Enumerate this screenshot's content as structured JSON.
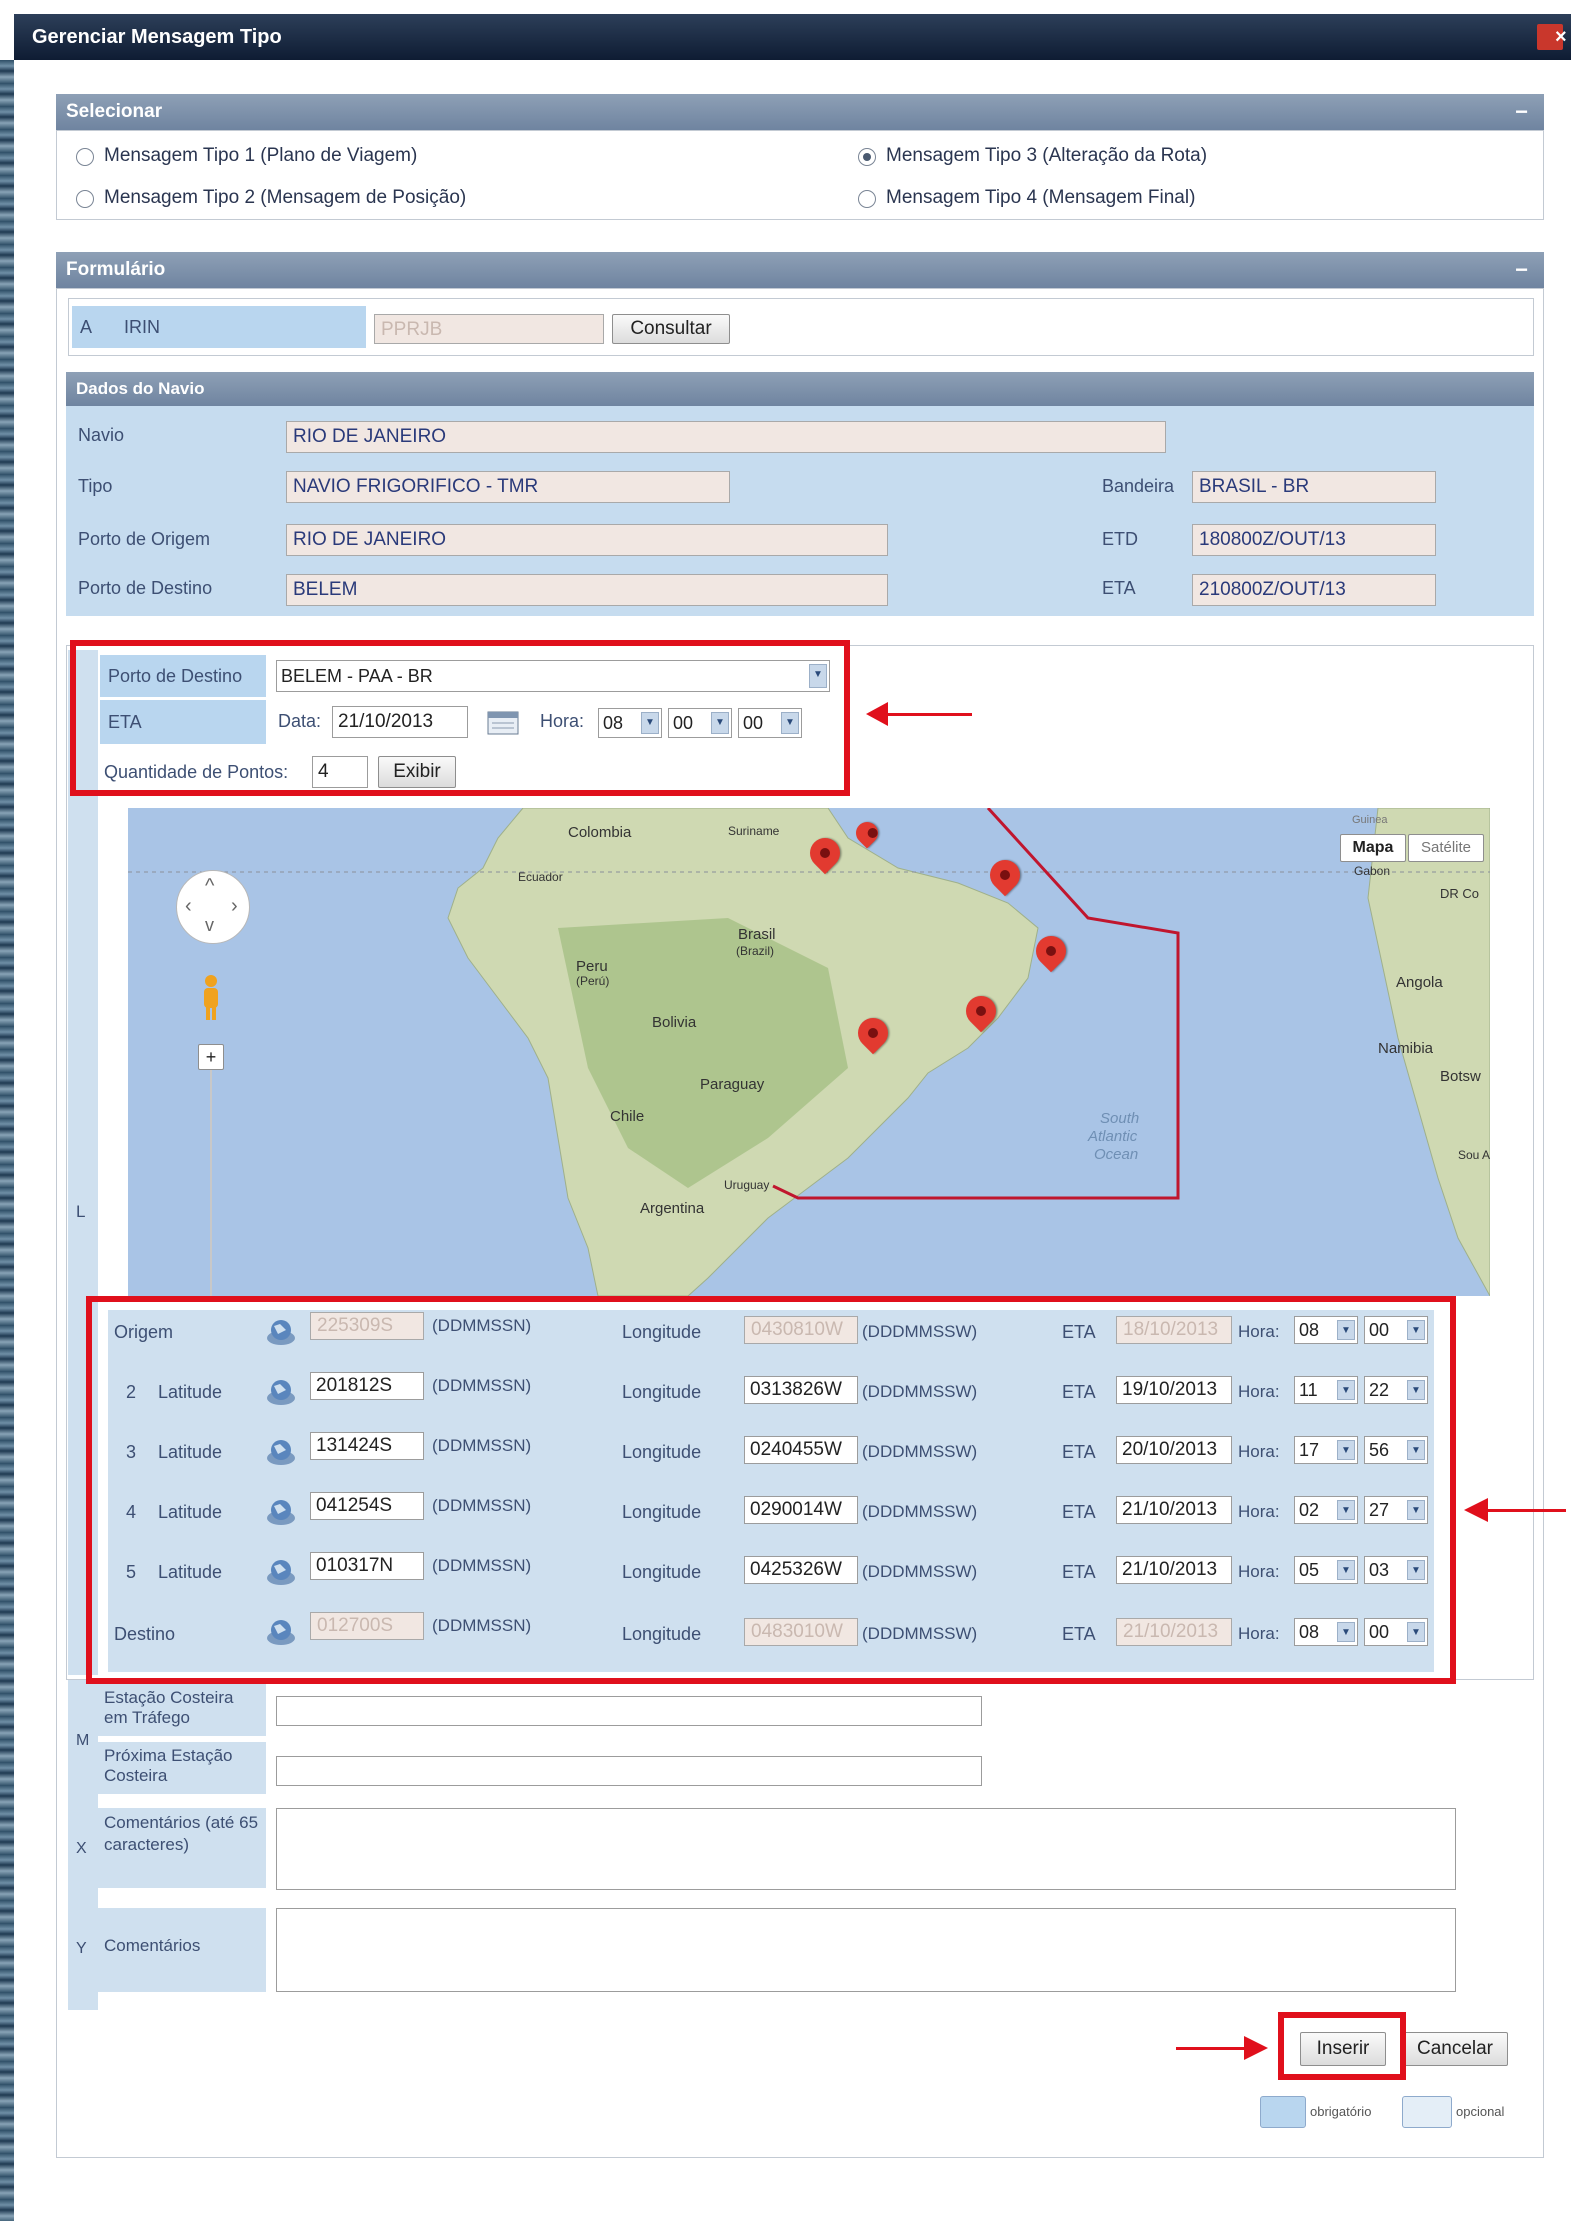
{
  "window": {
    "title": "Gerenciar Mensagem Tipo",
    "close": "×"
  },
  "selecionar": {
    "title": "Selecionar",
    "collapse": "−",
    "options": [
      {
        "label": "Mensagem Tipo 1 (Plano de Viagem)",
        "selected": false
      },
      {
        "label": "Mensagem Tipo 2 (Mensagem de Posição)",
        "selected": false
      },
      {
        "label": "Mensagem Tipo 3 (Alteração da Rota)",
        "selected": true
      },
      {
        "label": "Mensagem Tipo 4 (Mensagem Final)",
        "selected": false
      }
    ]
  },
  "formulario": {
    "title": "Formulário",
    "collapse": "−",
    "irin": {
      "letter": "A",
      "label": "IRIN",
      "value": "PPRJB",
      "button": "Consultar"
    }
  },
  "navio": {
    "title": "Dados do Navio",
    "fields": {
      "navio": {
        "label": "Navio",
        "value": "RIO DE JANEIRO"
      },
      "tipo": {
        "label": "Tipo",
        "value": "NAVIO FRIGORIFICO - TMR"
      },
      "bandeira": {
        "label": "Bandeira",
        "value": "BRASIL - BR"
      },
      "origem": {
        "label": "Porto de Origem",
        "value": "RIO DE JANEIRO"
      },
      "etd": {
        "label": "ETD",
        "value": "180800Z/OUT/13"
      },
      "destino": {
        "label": "Porto de Destino",
        "value": "BELEM"
      },
      "eta": {
        "label": "ETA",
        "value": "210800Z/OUT/13"
      }
    }
  },
  "rota": {
    "porto_label": "Porto de Destino",
    "porto_value": "BELEM - PAA - BR",
    "eta_label": "ETA",
    "data_label": "Data:",
    "data_value": "21/10/2013",
    "hora_label": "Hora:",
    "hora_values": [
      "08",
      "00",
      "00"
    ],
    "qtd_label": "Quantidade de Pontos:",
    "qtd_value": "4",
    "exibir": "Exibir",
    "l_letter": "L"
  },
  "map": {
    "mapa_btn": "Mapa",
    "satelite_btn": "Satélite",
    "zoom_in": "+",
    "labels": [
      "Colombia",
      "Suriname",
      "Ecuador",
      "Brasil",
      "(Brazil)",
      "Peru",
      "(Perú)",
      "Bolivia",
      "Paraguay",
      "Chile",
      "Uruguay",
      "Argentina",
      "South",
      "Atlantic",
      "Ocean",
      "Angola",
      "Namibia",
      "Botsw",
      "Gabon",
      "DR Co",
      "Guinea",
      "Sou Afr"
    ]
  },
  "pontos": {
    "lat_fmt": "(DDMMSSN)",
    "lon_fmt": "(DDDMMSSW)",
    "lon_label": "Longitude",
    "eta_label": "ETA",
    "hora_label": "Hora:",
    "rows": [
      {
        "num": "",
        "label": "Origem",
        "lat": "225309S",
        "lon": "0430810W",
        "eta": "18/10/2013",
        "h": "08",
        "m": "00",
        "disabled": true
      },
      {
        "num": "2",
        "label": "Latitude",
        "lat": "201812S",
        "lon": "0313826W",
        "eta": "19/10/2013",
        "h": "11",
        "m": "22",
        "disabled": false
      },
      {
        "num": "3",
        "label": "Latitude",
        "lat": "131424S",
        "lon": "0240455W",
        "eta": "20/10/2013",
        "h": "17",
        "m": "56",
        "disabled": false
      },
      {
        "num": "4",
        "label": "Latitude",
        "lat": "041254S",
        "lon": "0290014W",
        "eta": "21/10/2013",
        "h": "02",
        "m": "27",
        "disabled": false
      },
      {
        "num": "5",
        "label": "Latitude",
        "lat": "010317N",
        "lon": "0425326W",
        "eta": "21/10/2013",
        "h": "05",
        "m": "03",
        "disabled": false
      },
      {
        "num": "",
        "label": "Destino",
        "lat": "012700S",
        "lon": "0483010W",
        "eta": "21/10/2013",
        "h": "08",
        "m": "00",
        "disabled": true
      }
    ]
  },
  "extra": {
    "m_letter": "M",
    "estacao_trafego": "Estação Costeira em Tráfego",
    "proxima_estacao": "Próxima Estação Costeira",
    "x_letter": "X",
    "comentarios_65": "Comentários (até 65 caracteres)",
    "y_letter": "Y",
    "comentarios": "Comentários"
  },
  "actions": {
    "inserir": "Inserir",
    "cancelar": "Cancelar"
  },
  "legend": {
    "obrigatorio": "obrigatório",
    "opcional": "opcional"
  },
  "colors": {
    "highlight": "#e0101c",
    "required": "#b9d6ef",
    "optional": "#e4eef7",
    "header": "#7c8fa9"
  }
}
